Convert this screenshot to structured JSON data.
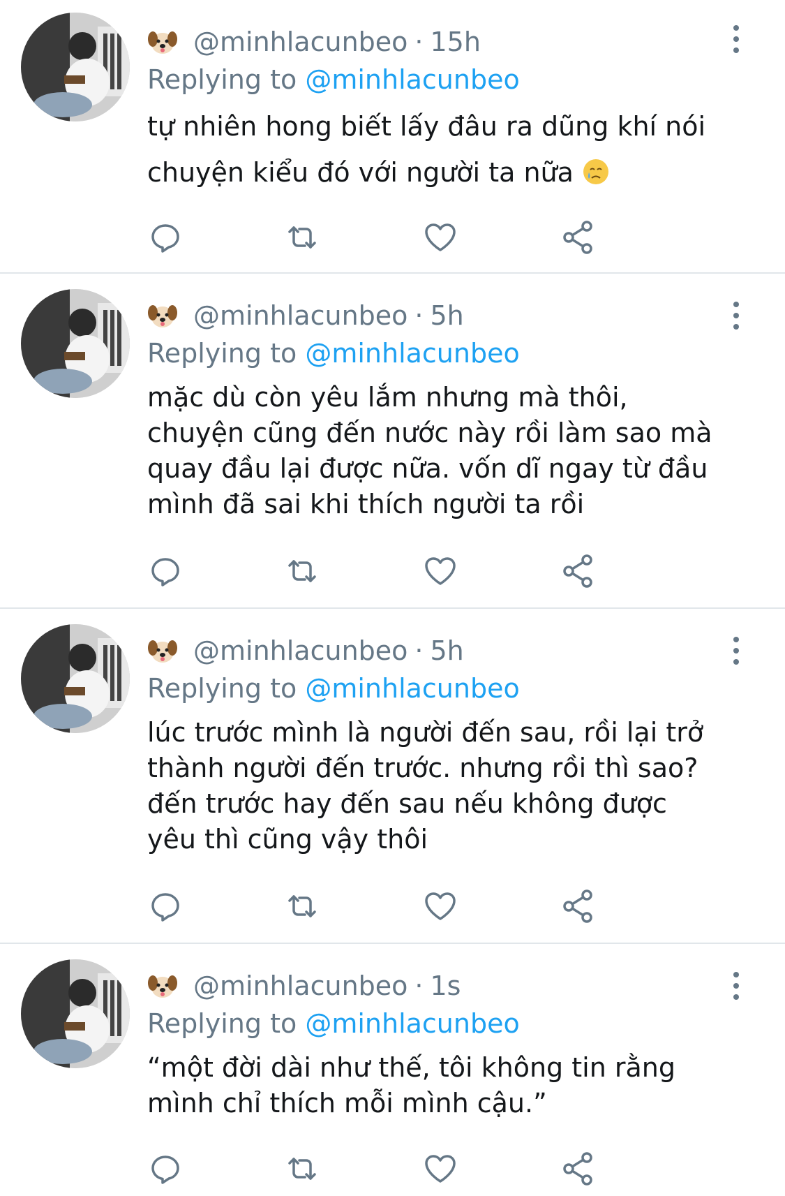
{
  "tweets": [
    {
      "handle": "@minhlacunbeo",
      "time": "15h",
      "replying_prefix": "Replying to",
      "replying_to": "@minhlacunbeo",
      "text": "tự nhiên hong biết lấy đâu ra dũng khí nói\nchuyện kiểu đó với người ta nữa",
      "emoji": "crying-face"
    },
    {
      "handle": "@minhlacunbeo",
      "time": "5h",
      "replying_prefix": "Replying to",
      "replying_to": "@minhlacunbeo",
      "text": "mặc dù còn yêu lắm nhưng mà thôi,\nchuyện cũng đến nước này rồi làm sao mà\nquay đầu lại được nữa. vốn dĩ ngay từ đầu\nmình đã sai khi thích người ta rồi"
    },
    {
      "handle": "@minhlacunbeo",
      "time": "5h",
      "replying_prefix": "Replying to",
      "replying_to": "@minhlacunbeo",
      "text": "lúc trước mình là người đến sau, rồi lại trở\nthành người đến trước. nhưng rồi thì sao?\nđến trước hay đến sau nếu không được\nyêu thì cũng vậy thôi"
    },
    {
      "handle": "@minhlacunbeo",
      "time": "1s",
      "replying_prefix": "Replying to",
      "replying_to": "@minhlacunbeo",
      "text": "“một đời dài như thế, tôi không tin rằng\nmình chỉ thích mỗi mình cậu.”"
    }
  ],
  "separator": "·",
  "colors": {
    "muted": "#657786",
    "link": "#1da1f2",
    "text": "#14171a",
    "divider": "#e1e6ea"
  },
  "icons": [
    "dog-emoji-icon",
    "more-vertical-icon",
    "reply-icon",
    "retweet-icon",
    "like-icon",
    "share-icon"
  ]
}
